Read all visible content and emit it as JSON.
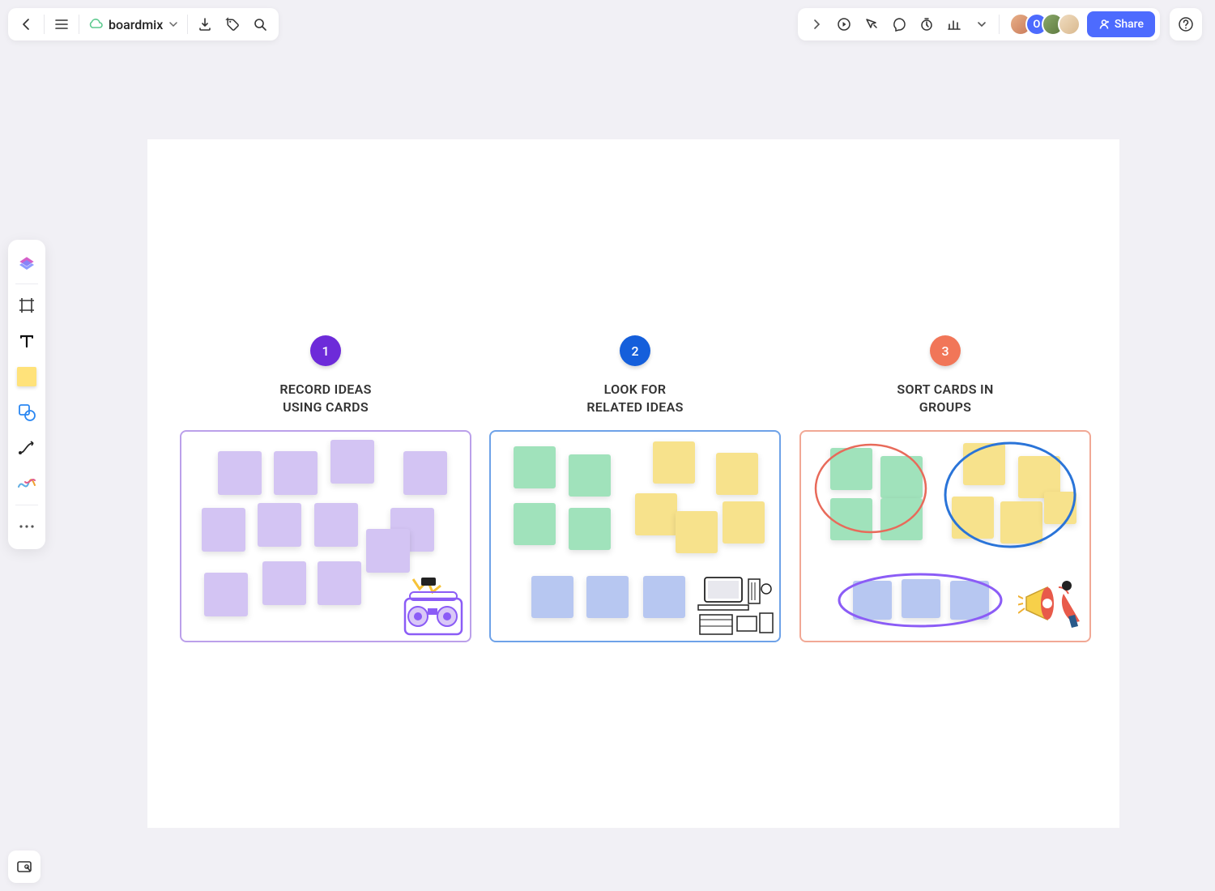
{
  "app": {
    "title": "boardmix"
  },
  "topbar": {
    "share_label": "Share"
  },
  "steps": [
    {
      "number": "1",
      "title_line1": "RECORD IDEAS",
      "title_line2": "USING CARDS",
      "badge_color": "#6d2bd9",
      "border_color": "#bba0ea"
    },
    {
      "number": "2",
      "title_line1": "LOOK FOR",
      "title_line2": "RELATED IDEAS",
      "badge_color": "#155fdb",
      "border_color": "#6ea2e8"
    },
    {
      "number": "3",
      "title_line1": "SORT CARDS IN",
      "title_line2": "GROUPS",
      "badge_color": "#f17658",
      "border_color": "#f1a895"
    }
  ],
  "avatar_colors": [
    "#e8b088",
    "#4d6bfe",
    "#6a8a4a",
    "#e6c9a8"
  ],
  "avatar_label": "O",
  "colors": {
    "share_button": "#4d6bfe",
    "note_purple": "#d3c4f3",
    "note_green": "#a0e2bb",
    "note_yellow": "#f7e28c",
    "note_blue": "#b7c7f1"
  }
}
